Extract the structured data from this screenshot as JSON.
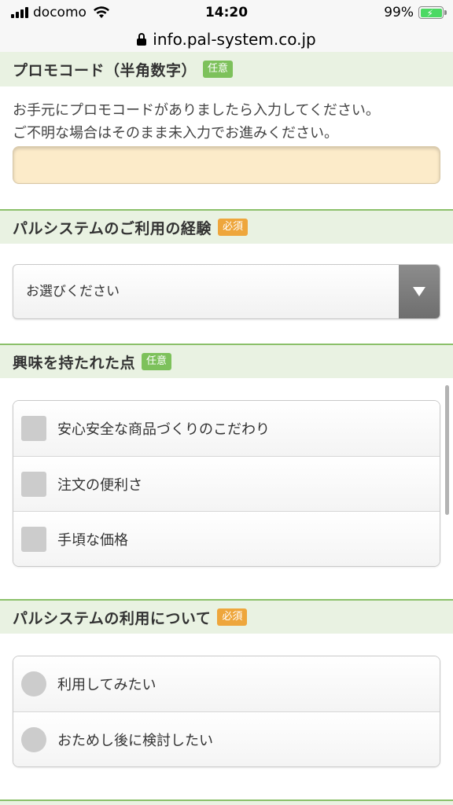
{
  "status_bar": {
    "carrier": "docomo",
    "time": "14:20",
    "battery": "99%"
  },
  "url_bar": {
    "url": "info.pal-system.co.jp"
  },
  "promo_section": {
    "title": "プロモコード（半角数字）",
    "badge": "任意",
    "desc_line1": "お手元にプロモコードがありましたら入力してください。",
    "desc_line2": "ご不明な場合はそのまま未入力でお進みください。",
    "input_value": "",
    "input_placeholder": ""
  },
  "experience_section": {
    "title": "パルシステムのご利用の経験",
    "badge": "必須",
    "select_value": "お選びください"
  },
  "interest_section": {
    "title": "興味を持たれた点",
    "badge": "任意",
    "options": [
      {
        "label": "安心安全な商品づくりのこだわり"
      },
      {
        "label": "注文の便利さ"
      },
      {
        "label": "手頃な価格"
      }
    ]
  },
  "usage_section": {
    "title": "パルシステムの利用について",
    "badge": "必須",
    "options": [
      {
        "label": "利用してみたい"
      },
      {
        "label": "おためし後に検討したい"
      }
    ]
  },
  "colors": {
    "section_header_bg": "#e9f2e2",
    "section_border": "#8bc06a",
    "optional_badge": "#7dc15b",
    "required_badge": "#eea63c",
    "input_bg": "#fcebc9"
  }
}
